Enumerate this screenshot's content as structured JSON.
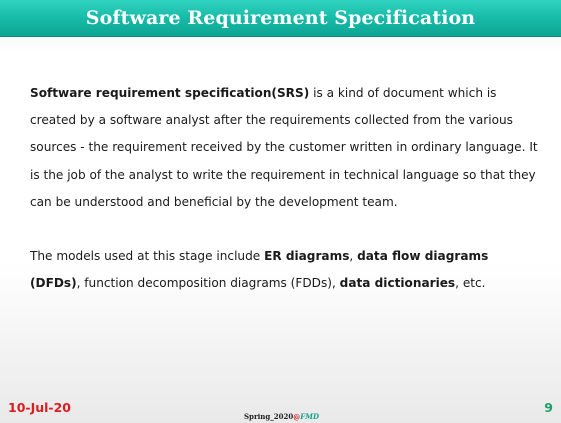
{
  "slide": {
    "title": "Software Requirement Specification",
    "paragraph1": {
      "term": "Software requirement specification(SRS)",
      "text": " is a kind of document which is created by a software analyst after the requirements collected from the various sources - the requirement received by the customer written in ordinary language. It is the job of the analyst to write the requirement in technical language so that they can be understood and beneficial by the development team."
    },
    "paragraph2": {
      "intro": "The models used at this stage include ",
      "er": "ER diagrams",
      "sep1": ", ",
      "dfd": "data flow diagrams (DFDs)",
      "sep2": ", function decomposition diagrams (FDDs), ",
      "dict": "data dictionaries",
      "outro": ", etc."
    }
  },
  "footer": {
    "date": "10-Jul-20",
    "credit_prefix": "Spring_2020",
    "credit_mark": "@",
    "credit_suffix": "FMD",
    "page_number": "9"
  },
  "colors": {
    "title_bar": "#17bba8",
    "title_text": "#ffffff",
    "date": "#d81e1e",
    "page_number": "#1a9e6e"
  }
}
